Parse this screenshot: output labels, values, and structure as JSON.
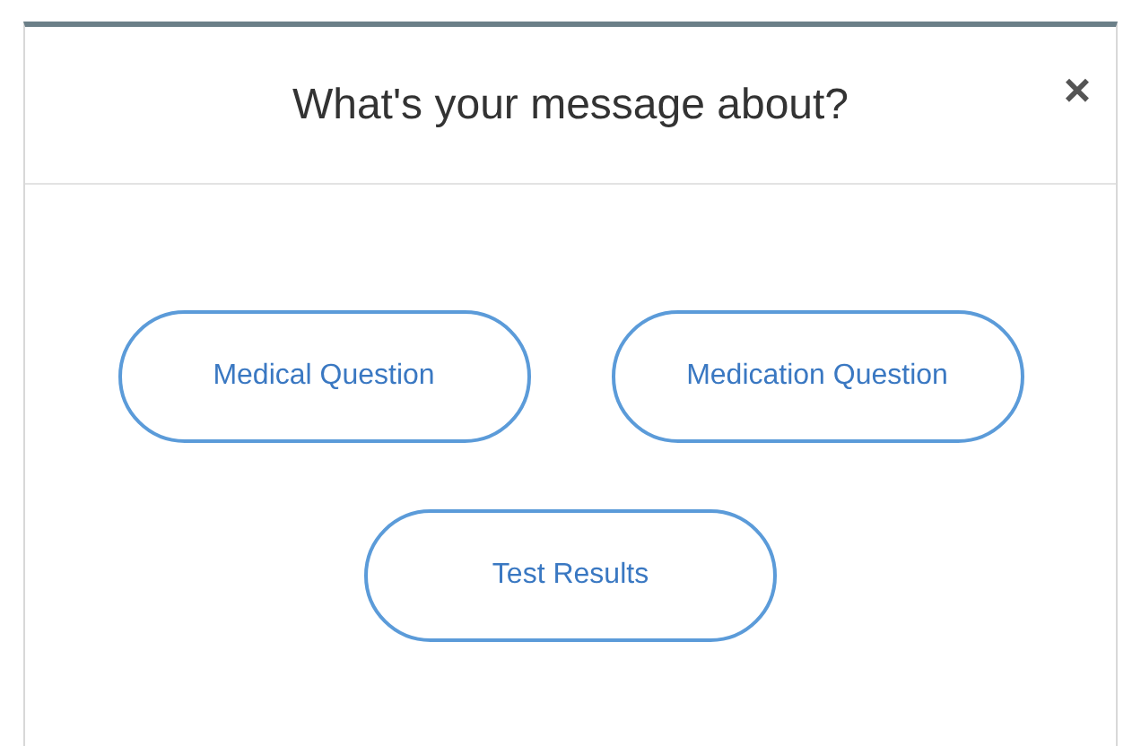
{
  "dialog": {
    "title": "What's your message about?",
    "close": "×"
  },
  "options": [
    {
      "label": "Medical Question"
    },
    {
      "label": "Medication Question"
    },
    {
      "label": "Test Results"
    }
  ]
}
